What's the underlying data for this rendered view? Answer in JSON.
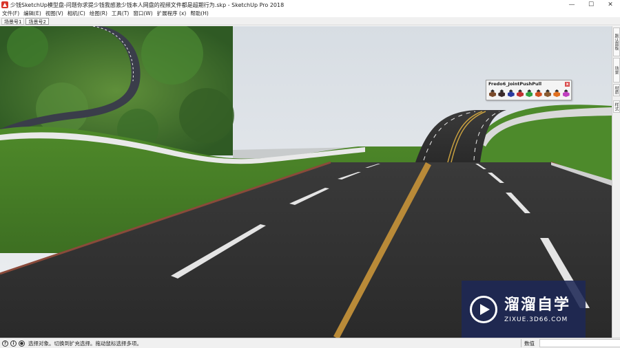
{
  "window": {
    "title": "少钱SketchUp模型盘-问题你求提少钱我感激少钱本人网盘的视频文件都是超期行为.skp - SketchUp Pro 2018",
    "minimize": "—",
    "maximize": "☐",
    "close": "✕"
  },
  "menu": [
    {
      "label": "文件(F)"
    },
    {
      "label": "编辑(E)"
    },
    {
      "label": "视图(V)"
    },
    {
      "label": "相机(C)"
    },
    {
      "label": "绘图(R)"
    },
    {
      "label": "工具(T)"
    },
    {
      "label": "窗口(W)"
    },
    {
      "label": "扩展程序 (x)"
    },
    {
      "label": "帮助(H)"
    }
  ],
  "scenes": [
    {
      "label": "场景号1"
    },
    {
      "label": "场景号2"
    }
  ],
  "right_tray": [
    {
      "label": "默认面板"
    },
    {
      "label": "场景"
    },
    {
      "label": "材质"
    },
    {
      "label": "样式"
    }
  ],
  "fredo_toolbar": {
    "title": "Fredo6_JointPushPull",
    "close": "x",
    "tools": [
      {
        "icon": "joint-pushpull-icon",
        "color": "#7a4a2a"
      },
      {
        "icon": "vector-pushpull-icon",
        "color": "#3a2a2a"
      },
      {
        "icon": "normal-pushpull-icon",
        "color": "#2a3aa0"
      },
      {
        "icon": "extrude-icon",
        "color": "#c03030"
      },
      {
        "icon": "follow-icon",
        "color": "#30a040"
      },
      {
        "icon": "undo-pushpull-icon",
        "color": "#d05020"
      },
      {
        "icon": "redo-pushpull-icon",
        "color": "#8a5a30"
      },
      {
        "icon": "finish-icon",
        "color": "#e07020"
      },
      {
        "icon": "options-icon",
        "color": "#c040c0"
      }
    ]
  },
  "watermark": {
    "name": "溜溜自学",
    "url": "ZIXUE.3D66.COM"
  },
  "status": {
    "icons": [
      {
        "glyph": "?"
      },
      {
        "glyph": "i"
      },
      {
        "glyph": "●"
      }
    ],
    "message": "选择对象。切换到扩充选择。拖动鼠标选择多项。",
    "measure_label": "数值",
    "measure_value": ""
  }
}
